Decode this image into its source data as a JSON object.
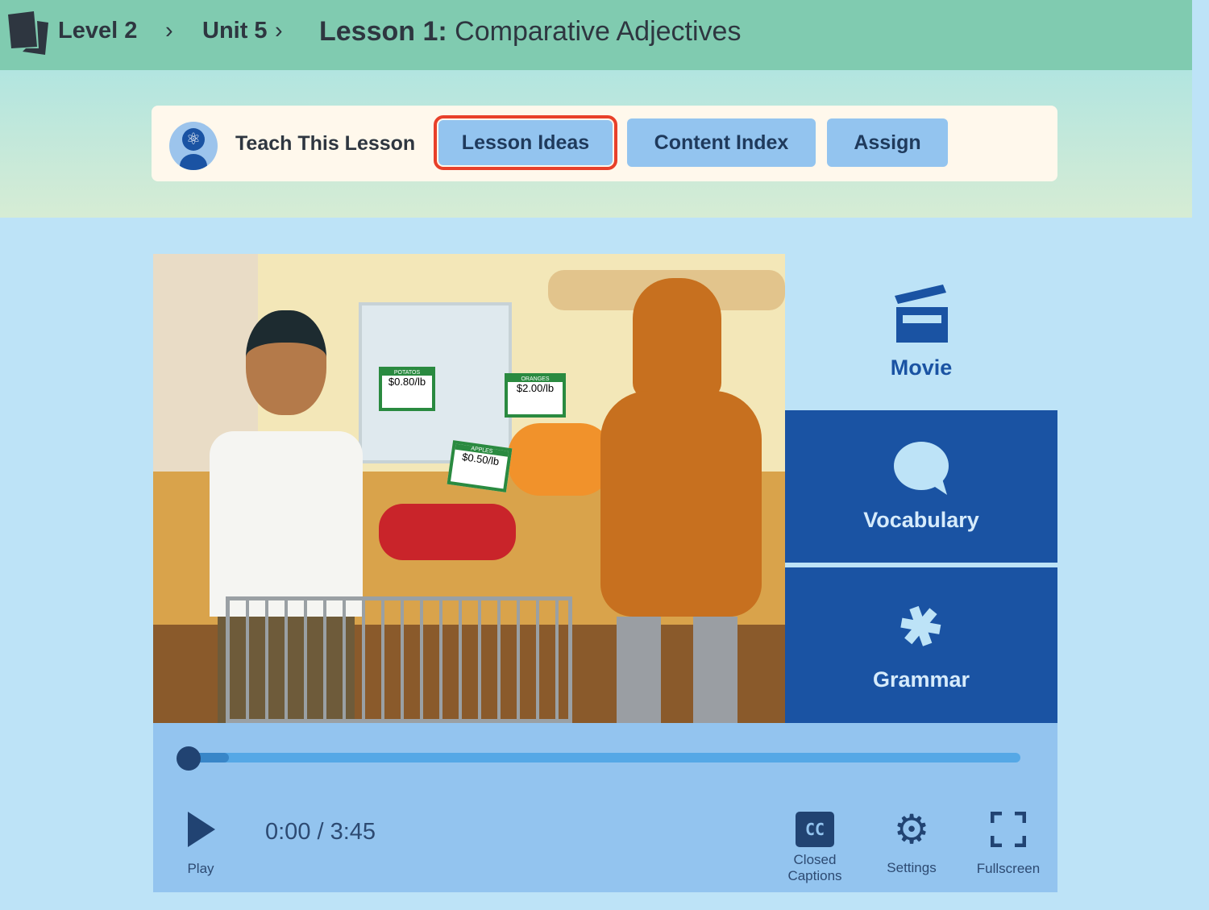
{
  "header": {
    "breadcrumb": [
      {
        "label": "Level 2"
      },
      {
        "label": "Unit 5"
      }
    ],
    "lesson_prefix": "Lesson 1:",
    "lesson_title": "Comparative Adjectives",
    "logo_icon": "brainpop-logo-icon"
  },
  "toolbar": {
    "teach_label": "Teach This Lesson",
    "buttons": [
      {
        "label": "Lesson Ideas",
        "highlighted": true
      },
      {
        "label": "Content Index"
      },
      {
        "label": "Assign"
      }
    ]
  },
  "video": {
    "price_tags": [
      "$0.80/lb",
      "$2.00/lb",
      "$0.50/lb"
    ],
    "tag_titles": [
      "POTATOS",
      "ORANGES",
      "APPLES"
    ]
  },
  "side": {
    "movie": "Movie",
    "vocabulary": "Vocabulary",
    "grammar": "Grammar"
  },
  "controls": {
    "progress_percent": 0,
    "time": "0:00 / 3:45",
    "play": "Play",
    "cc": "Closed Captions",
    "cc_glyph": "CC",
    "settings": "Settings",
    "fullscreen": "Fullscreen"
  },
  "colors": {
    "header": "#80cbb0",
    "dark_blue": "#1a53a3",
    "highlight": "#e8402a",
    "controls": "#93c4ef"
  }
}
